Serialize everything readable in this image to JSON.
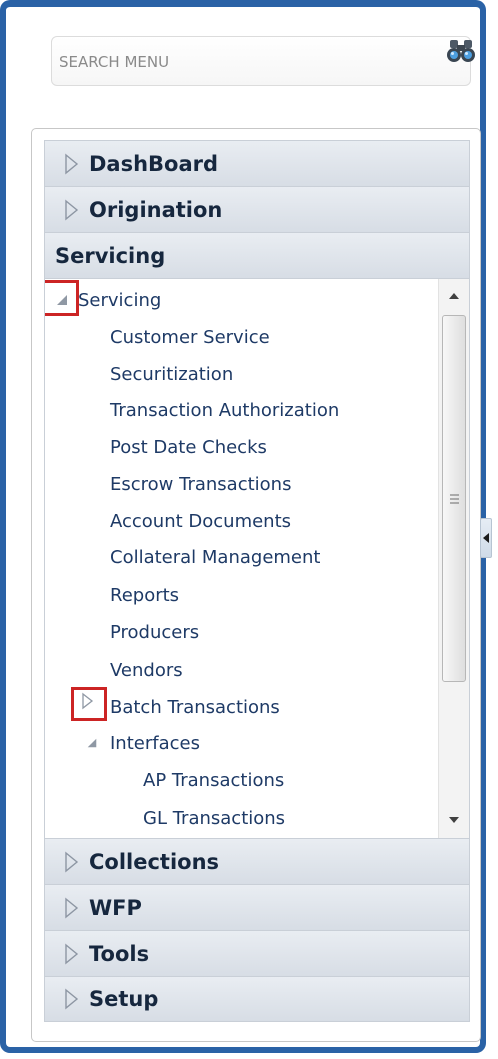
{
  "search": {
    "placeholder": "SEARCH MENU",
    "icon": "binoculars-icon"
  },
  "accordion": {
    "dashboard": "DashBoard",
    "origination": "Origination",
    "servicing": "Servicing",
    "collections": "Collections",
    "wfp": "WFP",
    "tools": "Tools",
    "setup": "Setup"
  },
  "tree": {
    "root": "Servicing",
    "items": [
      "Customer Service",
      "Securitization",
      "Transaction Authorization",
      "Post Date Checks",
      "Escrow Transactions",
      "Account Documents",
      "Collateral Management",
      "Reports",
      "Producers",
      "Vendors"
    ],
    "batch": "Batch Transactions",
    "interfaces": "Interfaces",
    "sub_items": [
      "AP Transactions",
      "GL Transactions"
    ]
  },
  "colors": {
    "frame_border": "#2a62a6",
    "header_text": "#16273e",
    "link_text": "#1e3a66",
    "highlight_box": "#cc2424"
  }
}
